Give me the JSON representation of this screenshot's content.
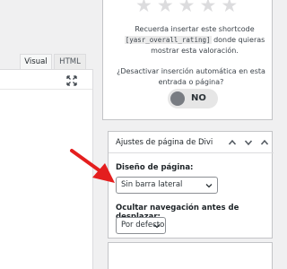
{
  "editor": {
    "tabs": [
      {
        "label": "Visual"
      },
      {
        "label": "HTML"
      }
    ],
    "fullscreen_icon": "fullscreen-icon"
  },
  "yasr": {
    "stars_icon": "star-icon",
    "star_count": 5,
    "shortcode_text_before": "Recuerda insertar este shortcode",
    "shortcode": "[yasr_overall_rating]",
    "shortcode_text_after": "donde quieras mostrar esta valoración.",
    "auto_insert_question": "¿Desactivar inserción automática en esta entrada o página?",
    "toggle_label": "NO"
  },
  "divi": {
    "title": "Ajustes de página de Divi",
    "layout_label": "Diseño de página:",
    "layout_value": "Sin barra lateral",
    "hide_nav_label": "Ocultar navegación antes de desplazar:",
    "hide_nav_value": "Por defecto"
  },
  "colors": {
    "annotation_arrow": "#e41e1e",
    "toggle_bg": "#e6e6e6",
    "toggle_knob": "#787c82"
  }
}
